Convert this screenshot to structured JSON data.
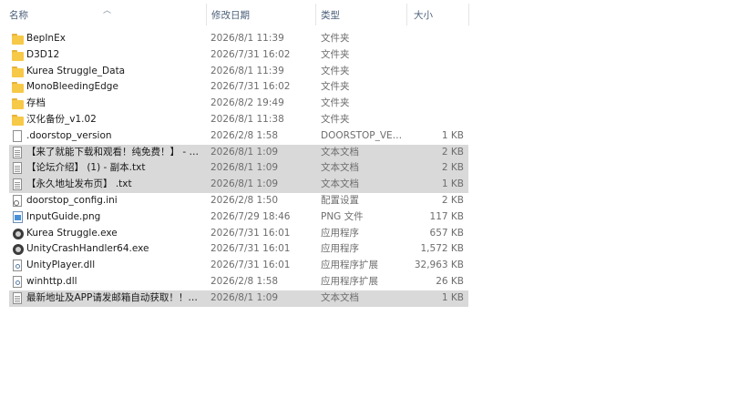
{
  "columns": {
    "name": "名称",
    "modified": "修改日期",
    "type": "类型",
    "size": "大小"
  },
  "colors": {
    "selected_row": "#d9d9d9",
    "header_text": "#4c607a",
    "folder": "#f7c948"
  },
  "files": [
    {
      "name": "BepInEx",
      "date": "2026/8/1 11:39",
      "type": "文件夹",
      "size": "",
      "icon": "folder-icon",
      "selected": false
    },
    {
      "name": "D3D12",
      "date": "2026/7/31 16:02",
      "type": "文件夹",
      "size": "",
      "icon": "folder-icon",
      "selected": false
    },
    {
      "name": "Kurea Struggle_Data",
      "date": "2026/8/1 11:39",
      "type": "文件夹",
      "size": "",
      "icon": "folder-icon",
      "selected": false
    },
    {
      "name": "MonoBleedingEdge",
      "date": "2026/7/31 16:02",
      "type": "文件夹",
      "size": "",
      "icon": "folder-icon",
      "selected": false
    },
    {
      "name": "存档",
      "date": "2026/8/2 19:49",
      "type": "文件夹",
      "size": "",
      "icon": "folder-icon",
      "selected": false
    },
    {
      "name": "汉化备份_v1.02",
      "date": "2026/8/1 11:38",
      "type": "文件夹",
      "size": "",
      "icon": "folder-icon",
      "selected": false
    },
    {
      "name": ".doorstop_version",
      "date": "2026/2/8 1:58",
      "type": "DOORSTOP_VER...",
      "size": "1 KB",
      "icon": "file-icon",
      "selected": false
    },
    {
      "name": "【来了就能下载和观看！纯免费！】 - 副...",
      "date": "2026/8/1 1:09",
      "type": "文本文档",
      "size": "2 KB",
      "icon": "text-file-icon",
      "selected": true
    },
    {
      "name": "【论坛介绍】 (1) - 副本.txt",
      "date": "2026/8/1 1:09",
      "type": "文本文档",
      "size": "2 KB",
      "icon": "text-file-icon",
      "selected": true
    },
    {
      "name": "【永久地址发布页】 .txt",
      "date": "2026/8/1 1:09",
      "type": "文本文档",
      "size": "1 KB",
      "icon": "text-file-icon",
      "selected": true
    },
    {
      "name": "doorstop_config.ini",
      "date": "2026/2/8 1:50",
      "type": "配置设置",
      "size": "2 KB",
      "icon": "config-file-icon",
      "selected": false
    },
    {
      "name": "InputGuide.png",
      "date": "2026/7/29 18:46",
      "type": "PNG 文件",
      "size": "117 KB",
      "icon": "image-file-icon",
      "selected": false
    },
    {
      "name": "Kurea Struggle.exe",
      "date": "2026/7/31 16:01",
      "type": "应用程序",
      "size": "657 KB",
      "icon": "unity-exe-icon",
      "selected": false
    },
    {
      "name": "UnityCrashHandler64.exe",
      "date": "2026/7/31 16:01",
      "type": "应用程序",
      "size": "1,572 KB",
      "icon": "unity-exe-icon",
      "selected": false
    },
    {
      "name": "UnityPlayer.dll",
      "date": "2026/7/31 16:01",
      "type": "应用程序扩展",
      "size": "32,963 KB",
      "icon": "dll-file-icon",
      "selected": false
    },
    {
      "name": "winhttp.dll",
      "date": "2026/2/8 1:58",
      "type": "应用程序扩展",
      "size": "26 KB",
      "icon": "dll-file-icon",
      "selected": false
    },
    {
      "name": "最新地址及APP请发邮箱自动获取！！！...",
      "date": "2026/8/1 1:09",
      "type": "文本文档",
      "size": "1 KB",
      "icon": "text-file-icon",
      "selected": true
    }
  ]
}
